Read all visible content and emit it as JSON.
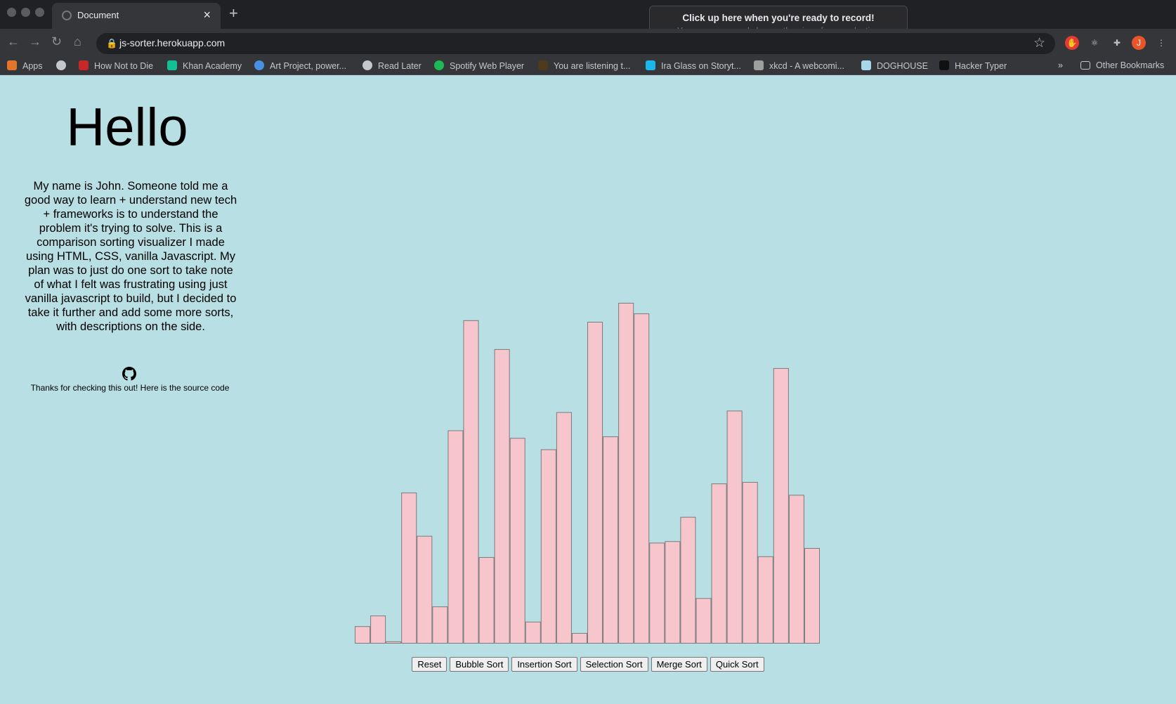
{
  "browser": {
    "tab_title": "Document",
    "url": "js-sorter.herokuapp.com",
    "profile_initial": "J",
    "record_popup": {
      "title": "Click up here when you're ready to record!",
      "subtitle": "You can move and change the size of your selection"
    },
    "bookmarks": [
      {
        "label": "Apps",
        "icon": "apps-grid-icon",
        "color": "#e3742b"
      },
      {
        "label": "",
        "icon": "globe-icon",
        "color": "#c4c7cc"
      },
      {
        "label": "How Not to Die",
        "icon": "site-favicon",
        "color": "#c62828"
      },
      {
        "label": "Khan Academy",
        "icon": "khan-icon",
        "color": "#14bf96"
      },
      {
        "label": "Art Project, power...",
        "icon": "museum-icon",
        "color": "#4a90e2"
      },
      {
        "label": "Read Later",
        "icon": "globe-icon",
        "color": "#c4c7cc"
      },
      {
        "label": "Spotify Web Player",
        "icon": "spotify-icon",
        "color": "#1db954"
      },
      {
        "label": "You are listening t...",
        "icon": "site-favicon",
        "color": "#4e3b1c"
      },
      {
        "label": "Ira Glass on Storyt...",
        "icon": "vimeo-icon",
        "color": "#1ab7ea"
      },
      {
        "label": "xkcd - A webcomi...",
        "icon": "xkcd-icon",
        "color": "#9e9e9e"
      },
      {
        "label": "DOGHOUSE",
        "icon": "site-favicon",
        "color": "#a7d7e8"
      },
      {
        "label": "Hacker Typer",
        "icon": "terminal-icon",
        "color": "#111111"
      }
    ],
    "more_label": "»",
    "other_bookmarks": "Other Bookmarks"
  },
  "page": {
    "heading": "Hello",
    "intro": "My name is John. Someone told me a good way to learn + understand new tech + frameworks is to understand the problem it's trying to solve. This is a comparison sorting visualizer I made using HTML, CSS, vanilla Javascript. My plan was to just do one sort to take note of what I felt was frustrating using just vanilla javascript to build, but I decided to take it further and add some more sorts, with descriptions on the side.",
    "thanks": "Thanks for checking this out! Here is the source code",
    "buttons": [
      "Reset",
      "Bubble Sort",
      "Insertion Sort",
      "Selection Sort",
      "Merge Sort",
      "Quick Sort"
    ]
  },
  "chart_data": {
    "type": "bar",
    "values": [
      22,
      36,
      2,
      198,
      141,
      48,
      280,
      425,
      113,
      387,
      270,
      28,
      255,
      304,
      13,
      423,
      272,
      448,
      434,
      132,
      134,
      166,
      59,
      210,
      306,
      212,
      114,
      362,
      195,
      125
    ],
    "ylim": [
      0,
      448
    ],
    "bar_color": "#f7c5cc",
    "stroke_color": "#7b7b7b"
  }
}
